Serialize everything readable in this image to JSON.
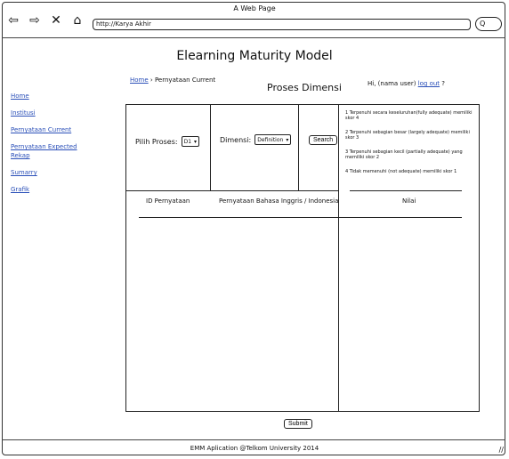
{
  "window": {
    "title": "A Web Page",
    "address": "http://Karya Akhir",
    "search_placeholder": "Q"
  },
  "app": {
    "title": "Elearning Maturity Model"
  },
  "breadcrumb": {
    "home": "Home",
    "separator": "›",
    "current": "Pernyataan Current"
  },
  "page": {
    "heading": "Proses Dimensi"
  },
  "user": {
    "greeting": "Hi, (nama user)",
    "logout": "log out",
    "help": "?"
  },
  "sidebar": {
    "items": [
      {
        "label": "Home"
      },
      {
        "label": "Institusi"
      },
      {
        "label": "Pernyataan Current"
      },
      {
        "label": "Pernyataan Expected"
      },
      {
        "label": "Rekap"
      },
      {
        "label": "Sumarry"
      },
      {
        "label": "Grafik"
      }
    ]
  },
  "filters": {
    "proses_label": "Pilih Proses:",
    "proses_value": "D1",
    "dimensi_label": "Dimensi:",
    "dimensi_value": "Definition",
    "search_button": "Search"
  },
  "legend": [
    "1 Terpenuhi secara keseluruhan(fully adequate) memiliki skor 4",
    "2 Terpenuhi sebagian besar (largely adequate) memiliki skor 3",
    "3 Terpenuhi sebagian kecil (partially adequate) yang memiliki skor 2",
    "4 Tidak memenuhi (not adequate) memiliki skor 1"
  ],
  "table": {
    "columns": [
      "ID Pernyataan",
      "Pernyataan Bahasa Inggris / Indonesia",
      "Nilai"
    ]
  },
  "submit": {
    "label": "Submit"
  },
  "footer": {
    "text": "EMM Aplication @Telkom University 2014"
  }
}
